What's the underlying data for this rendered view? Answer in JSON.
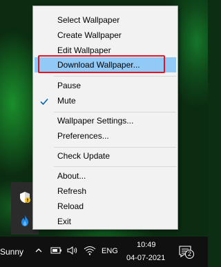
{
  "menu": {
    "items": [
      {
        "label": "Select Wallpaper"
      },
      {
        "label": "Create Wallpaper"
      },
      {
        "label": "Edit Wallpaper"
      },
      {
        "label": "Download Wallpaper..."
      },
      {
        "label": "Pause"
      },
      {
        "label": "Mute"
      },
      {
        "label": "Wallpaper Settings..."
      },
      {
        "label": "Preferences..."
      },
      {
        "label": "Check Update"
      },
      {
        "label": "About..."
      },
      {
        "label": "Refresh"
      },
      {
        "label": "Reload"
      },
      {
        "label": "Exit"
      }
    ],
    "highlighted_item": "Download Wallpaper...",
    "checked_item": "Mute",
    "highlight_color": "#91c9f7",
    "annotation_frame_color": "#e81123"
  },
  "tray_overflow": {
    "icons": [
      "shield-warning-icon",
      "flame-icon"
    ]
  },
  "taskbar": {
    "weather": "Sunny",
    "language": "ENG",
    "time": "10:49",
    "date": "04-07-2021",
    "notification_count": "2",
    "icons": [
      "chevron-up-icon",
      "battery-icon",
      "volume-icon",
      "wifi-icon",
      "notification-icon"
    ]
  }
}
